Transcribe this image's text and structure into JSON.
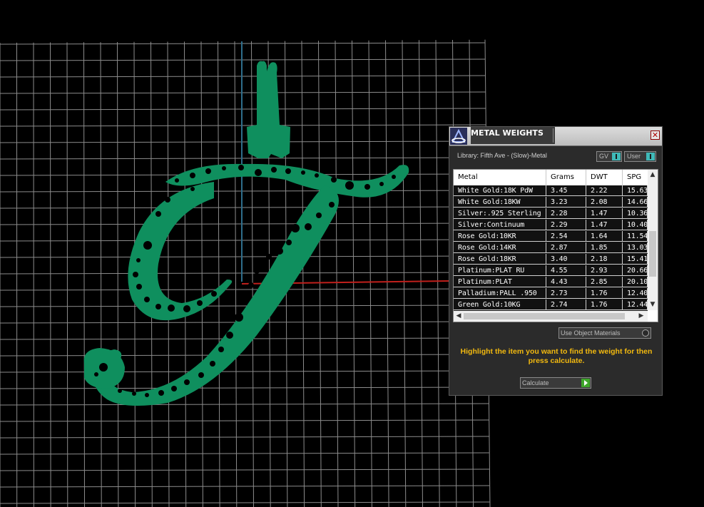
{
  "panel": {
    "title": "METAL WEIGHTS",
    "close_glyph": "✕",
    "library_label": "Library: Fifth Ave - (Slow)-Metal",
    "toggle_gv": "GV",
    "toggle_user": "User",
    "columns": [
      "Metal",
      "Grams",
      "DWT",
      "SPG"
    ],
    "rows": [
      [
        "White Gold:18K PdW",
        "3.45",
        "2.22",
        "15.63"
      ],
      [
        "White Gold:18KW",
        "3.23",
        "2.08",
        "14.66"
      ],
      [
        "Silver:.925 Sterling",
        "2.28",
        "1.47",
        "10.36"
      ],
      [
        "Silver:Continuum",
        "2.29",
        "1.47",
        "10.40"
      ],
      [
        "Rose Gold:10KR",
        "2.54",
        "1.64",
        "11.54"
      ],
      [
        "Rose Gold:14KR",
        "2.87",
        "1.85",
        "13.03"
      ],
      [
        "Rose Gold:18KR",
        "3.40",
        "2.18",
        "15.41"
      ],
      [
        "Platinum:PLAT RU",
        "4.55",
        "2.93",
        "20.66"
      ],
      [
        "Platinum:PLAT",
        "4.43",
        "2.85",
        "20.10"
      ],
      [
        "Palladium:PALL .950",
        "2.73",
        "1.76",
        "12.40"
      ],
      [
        "Green Gold:10KG",
        "2.74",
        "1.76",
        "12.44"
      ]
    ],
    "use_object_materials": "Use Object Materials",
    "hint": "Highlight the item you want to find the weight for then press calculate.",
    "calculate": "Calculate"
  },
  "icons": {
    "logo": "app-logo-icon",
    "close": "close-icon",
    "scroll_up": "▲",
    "scroll_down": "▼",
    "scroll_left": "◀",
    "scroll_right": "▶"
  },
  "colors": {
    "model": "#0f8f5e",
    "grid": "#8c8c8c",
    "axis_x": "#c0201c",
    "axis_y": "#2e6d8a",
    "hint": "#f2b90f",
    "toggle_on": "#3fb9b8",
    "calculate_go": "#3ea62a"
  }
}
